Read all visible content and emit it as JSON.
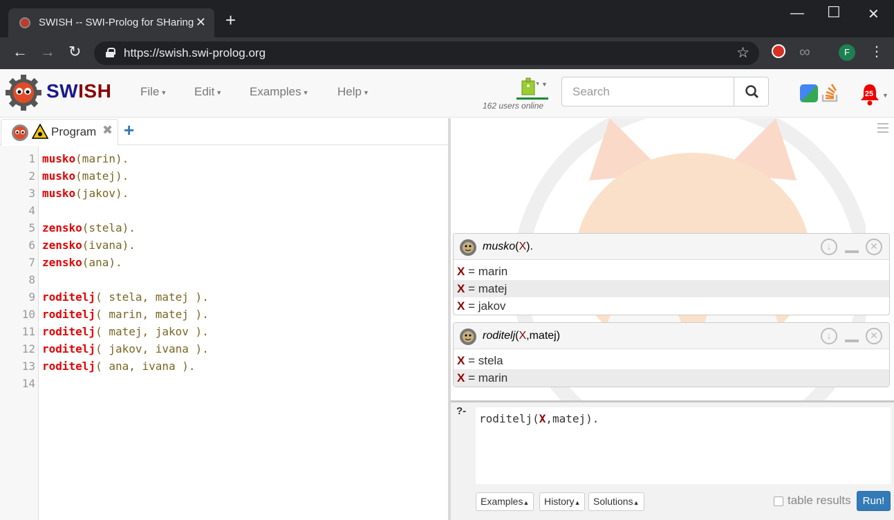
{
  "browser": {
    "tab_title": "SWISH -- SWI-Prolog for SHaring",
    "tab_close": "✕",
    "new_tab": "+",
    "url": "https://swish.swi-prolog.org",
    "profile_initial": "F",
    "window_controls": {
      "minimize": "—",
      "maximize": "☐",
      "close": "✕"
    }
  },
  "navbar": {
    "brand_sw": "SW",
    "brand_i": "I",
    "brand_sh": "SH",
    "menus": [
      "File",
      "Edit",
      "Examples",
      "Help"
    ],
    "users_online": "162 users online",
    "search_placeholder": "Search",
    "notification_count": "25"
  },
  "editor": {
    "tab_label": "Program",
    "tab_close": "✖",
    "add_tab": "+",
    "lines": [
      {
        "num": "1",
        "pred": "musko",
        "rest": "(marin)."
      },
      {
        "num": "2",
        "pred": "musko",
        "rest": "(matej)."
      },
      {
        "num": "3",
        "pred": "musko",
        "rest": "(jakov)."
      },
      {
        "num": "4",
        "pred": "",
        "rest": ""
      },
      {
        "num": "5",
        "pred": "zensko",
        "rest": "(stela)."
      },
      {
        "num": "6",
        "pred": "zensko",
        "rest": "(ivana)."
      },
      {
        "num": "7",
        "pred": "zensko",
        "rest": "(ana)."
      },
      {
        "num": "8",
        "pred": "",
        "rest": ""
      },
      {
        "num": "9",
        "pred": "roditelj",
        "rest": "( stela, matej )."
      },
      {
        "num": "10",
        "pred": "roditelj",
        "rest": "( marin, matej )."
      },
      {
        "num": "11",
        "pred": "roditelj",
        "rest": "( matej, jakov )."
      },
      {
        "num": "12",
        "pred": "roditelj",
        "rest": "( jakov, ivana )."
      },
      {
        "num": "13",
        "pred": "roditelj",
        "rest": "( ana, ivana )."
      },
      {
        "num": "14",
        "pred": "",
        "rest": ""
      }
    ]
  },
  "results": {
    "queries": [
      {
        "pred": "musko",
        "open": "(",
        "var": "X",
        "args": "",
        "close": ").",
        "answers": [
          {
            "var": "X",
            "eq": " = ",
            "val": "marin"
          },
          {
            "var": "X",
            "eq": " = ",
            "val": "matej"
          },
          {
            "var": "X",
            "eq": " = ",
            "val": "jakov"
          }
        ]
      },
      {
        "pred": "roditelj",
        "open": "(",
        "var": "X",
        "args": ",matej",
        "close": ")",
        "answers": [
          {
            "var": "X",
            "eq": " = ",
            "val": "stela"
          },
          {
            "var": "X",
            "eq": " = ",
            "val": "marin"
          }
        ]
      }
    ]
  },
  "query": {
    "prompt": "?-",
    "pred": "roditelj(",
    "var": "X",
    "rest": ",matej).",
    "buttons": [
      "Examples",
      "History",
      "Solutions"
    ],
    "table_results_label": "table results",
    "table_results_checked": false,
    "run_label": "Run!"
  },
  "colors": {
    "predicate": "#e40000",
    "atom": "#776622",
    "variable": "#8b0000",
    "run_button": "#337ab7",
    "online_bar": "#15892d"
  }
}
